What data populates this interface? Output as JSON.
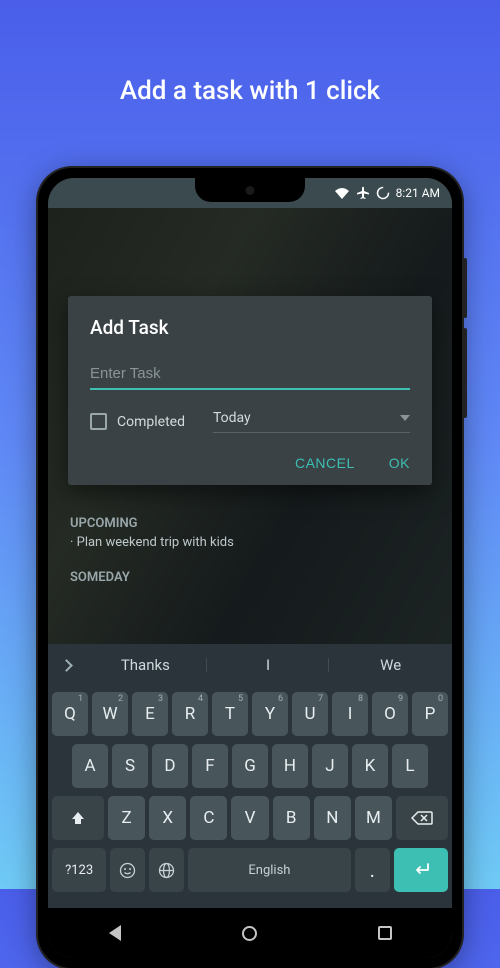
{
  "heading": "Add a task with 1 click",
  "statusbar": {
    "time": "8:21 AM"
  },
  "dialog": {
    "title": "Add Task",
    "input_placeholder": "Enter Task",
    "completed_label": "Completed",
    "date_value": "Today",
    "cancel": "CANCEL",
    "ok": "OK"
  },
  "home": {
    "upcoming_label": "UPCOMING",
    "upcoming_item": "· Plan weekend trip with kids",
    "someday_label": "SOMEDAY"
  },
  "keyboard": {
    "suggestions": [
      "Thanks",
      "I",
      "We"
    ],
    "row1": [
      {
        "k": "Q",
        "n": "1"
      },
      {
        "k": "W",
        "n": "2"
      },
      {
        "k": "E",
        "n": "3"
      },
      {
        "k": "R",
        "n": "4"
      },
      {
        "k": "T",
        "n": "5"
      },
      {
        "k": "Y",
        "n": "6"
      },
      {
        "k": "U",
        "n": "7"
      },
      {
        "k": "I",
        "n": "8"
      },
      {
        "k": "O",
        "n": "9"
      },
      {
        "k": "P",
        "n": "0"
      }
    ],
    "row2": [
      "A",
      "S",
      "D",
      "F",
      "G",
      "H",
      "J",
      "K",
      "L"
    ],
    "row3": [
      "Z",
      "X",
      "C",
      "V",
      "B",
      "N",
      "M"
    ],
    "symbols_key": "?123",
    "space_label": "English"
  }
}
